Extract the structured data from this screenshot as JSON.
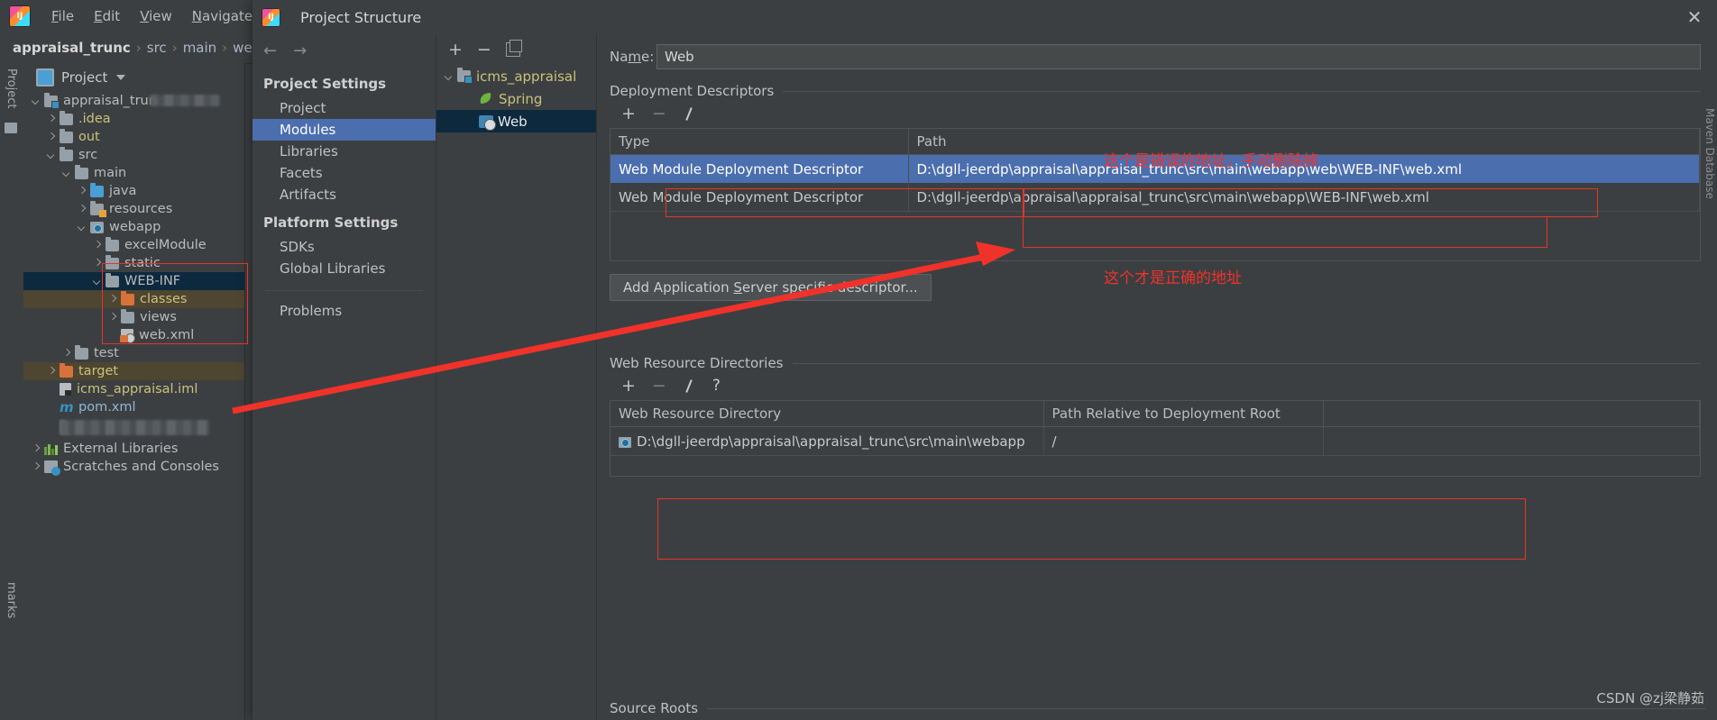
{
  "ide": {
    "logo": "intellij-idea-logo",
    "menus": [
      "File",
      "Edit",
      "View",
      "Navigate"
    ],
    "breadcrumb": [
      "appraisal_trunc",
      "src",
      "main",
      "web"
    ],
    "breadcrumb_separator": "›",
    "tool_strip_left": "Project",
    "tool_strip_bottom": "marks",
    "project_panel": {
      "header": "Project",
      "tree": [
        {
          "label": "appraisal_trunc",
          "depth": 0,
          "twisty": "down",
          "icon": "folder-module-icon",
          "color": "plain",
          "state": "normal",
          "blurred": true
        },
        {
          "label": ".idea",
          "depth": 1,
          "twisty": "right",
          "icon": "folder-gray-icon",
          "color": "yellow",
          "state": "normal"
        },
        {
          "label": "out",
          "depth": 1,
          "twisty": "right",
          "icon": "folder-gray-icon",
          "color": "yellow",
          "state": "normal"
        },
        {
          "label": "src",
          "depth": 1,
          "twisty": "down",
          "icon": "folder-gray-icon",
          "color": "plain",
          "state": "normal"
        },
        {
          "label": "main",
          "depth": 2,
          "twisty": "down",
          "icon": "folder-gray-icon",
          "color": "plain",
          "state": "normal"
        },
        {
          "label": "java",
          "depth": 3,
          "twisty": "right",
          "icon": "folder-source-icon",
          "color": "plain",
          "state": "normal"
        },
        {
          "label": "resources",
          "depth": 3,
          "twisty": "right",
          "icon": "folder-resources-icon",
          "color": "plain",
          "state": "normal"
        },
        {
          "label": "webapp",
          "depth": 3,
          "twisty": "down",
          "icon": "folder-webapp-icon",
          "color": "plain",
          "state": "normal"
        },
        {
          "label": "excelModule",
          "depth": 4,
          "twisty": "right",
          "icon": "folder-gray-icon",
          "color": "plain",
          "state": "normal"
        },
        {
          "label": "static",
          "depth": 4,
          "twisty": "right",
          "icon": "folder-gray-icon",
          "color": "plain",
          "state": "normal"
        },
        {
          "label": "WEB-INF",
          "depth": 4,
          "twisty": "down",
          "icon": "folder-gray-icon",
          "color": "plain",
          "state": "selected"
        },
        {
          "label": "classes",
          "depth": 5,
          "twisty": "right",
          "icon": "folder-orange-icon",
          "color": "yellow",
          "state": "highlighted"
        },
        {
          "label": "views",
          "depth": 5,
          "twisty": "right",
          "icon": "folder-gray-icon",
          "color": "plain",
          "state": "normal"
        },
        {
          "label": "web.xml",
          "depth": 5,
          "twisty": "none",
          "icon": "xml-file-icon",
          "color": "plain",
          "state": "normal"
        },
        {
          "label": "test",
          "depth": 2,
          "twisty": "right",
          "icon": "folder-gray-icon",
          "color": "plain",
          "state": "normal"
        },
        {
          "label": "target",
          "depth": 1,
          "twisty": "right",
          "icon": "folder-orange-icon",
          "color": "yellow",
          "state": "highlighted"
        },
        {
          "label": "icms_appraisal.iml",
          "depth": 1,
          "twisty": "none",
          "icon": "iml-file-icon",
          "color": "yellow",
          "state": "normal"
        },
        {
          "label": "pom.xml",
          "depth": 1,
          "twisty": "none",
          "icon": "maven-file-icon",
          "color": "blue",
          "state": "normal"
        },
        {
          "label": "",
          "depth": 1,
          "twisty": "none",
          "icon": "blurred-icon",
          "color": "plain",
          "state": "normal",
          "blurred_row": true
        },
        {
          "label": "External Libraries",
          "depth": 0,
          "twisty": "right",
          "icon": "libraries-icon",
          "color": "plain",
          "state": "normal"
        },
        {
          "label": "Scratches and Consoles",
          "depth": 0,
          "twisty": "right",
          "icon": "scratches-icon",
          "color": "plain",
          "state": "normal"
        }
      ]
    }
  },
  "dialog": {
    "title": "Project Structure",
    "close_label": "✕",
    "nav": {
      "back_icon": "arrow-left-icon",
      "forward_icon": "arrow-right-icon",
      "project_settings_header": "Project Settings",
      "project_settings": [
        "Project",
        "Modules",
        "Libraries",
        "Facets",
        "Artifacts"
      ],
      "active_item": "Modules",
      "platform_settings_header": "Platform Settings",
      "platform_settings": [
        "SDKs",
        "Global Libraries"
      ],
      "problems": "Problems"
    },
    "module_tree": {
      "toolbar": [
        "add-icon",
        "remove-icon",
        "copy-icon"
      ],
      "items": [
        {
          "label": "icms_appraisal",
          "depth": 0,
          "twisty": "down",
          "icon": "module-folder-icon",
          "selected": false
        },
        {
          "label": "Spring",
          "depth": 1,
          "twisty": "none",
          "icon": "spring-leaf-icon",
          "selected": false
        },
        {
          "label": "Web",
          "depth": 1,
          "twisty": "none",
          "icon": "web-facet-icon",
          "selected": true
        }
      ]
    },
    "main": {
      "name_label": "Name:",
      "name_value": "Web",
      "deployment_descriptors": {
        "title": "Deployment Descriptors",
        "toolbar": [
          "add-icon",
          "remove-icon",
          "edit-icon"
        ],
        "columns": [
          "Type",
          "Path"
        ],
        "rows": [
          {
            "type": "Web Module Deployment Descriptor",
            "path": "D:\\dgll-jeerdp\\appraisal\\appraisal_trunc\\src\\main\\webapp\\web\\WEB-INF\\web.xml",
            "selected": true
          },
          {
            "type": "Web Module Deployment Descriptor",
            "path": "D:\\dgll-jeerdp\\appraisal\\appraisal_trunc\\src\\main\\webapp\\WEB-INF\\web.xml",
            "selected": false
          }
        ]
      },
      "add_descriptor_button": "Add Application Server specific descriptor...",
      "web_resource_directories": {
        "title": "Web Resource Directories",
        "toolbar": [
          "add-icon",
          "remove-icon",
          "edit-icon",
          "help-icon"
        ],
        "columns": [
          "Web Resource Directory",
          "Path Relative to Deployment Root"
        ],
        "rows": [
          {
            "directory": "D:\\dgll-jeerdp\\appraisal\\appraisal_trunc\\src\\main\\webapp",
            "relative": "/"
          }
        ]
      },
      "source_roots_title": "Source Roots"
    }
  },
  "annotations": {
    "wrong_path_note": "这个是错误的地址，手动删除掉",
    "correct_path_note": "这个才是正确的地址",
    "accent_red": "#f0322a"
  },
  "watermark": "CSDN @zj梁静茹"
}
